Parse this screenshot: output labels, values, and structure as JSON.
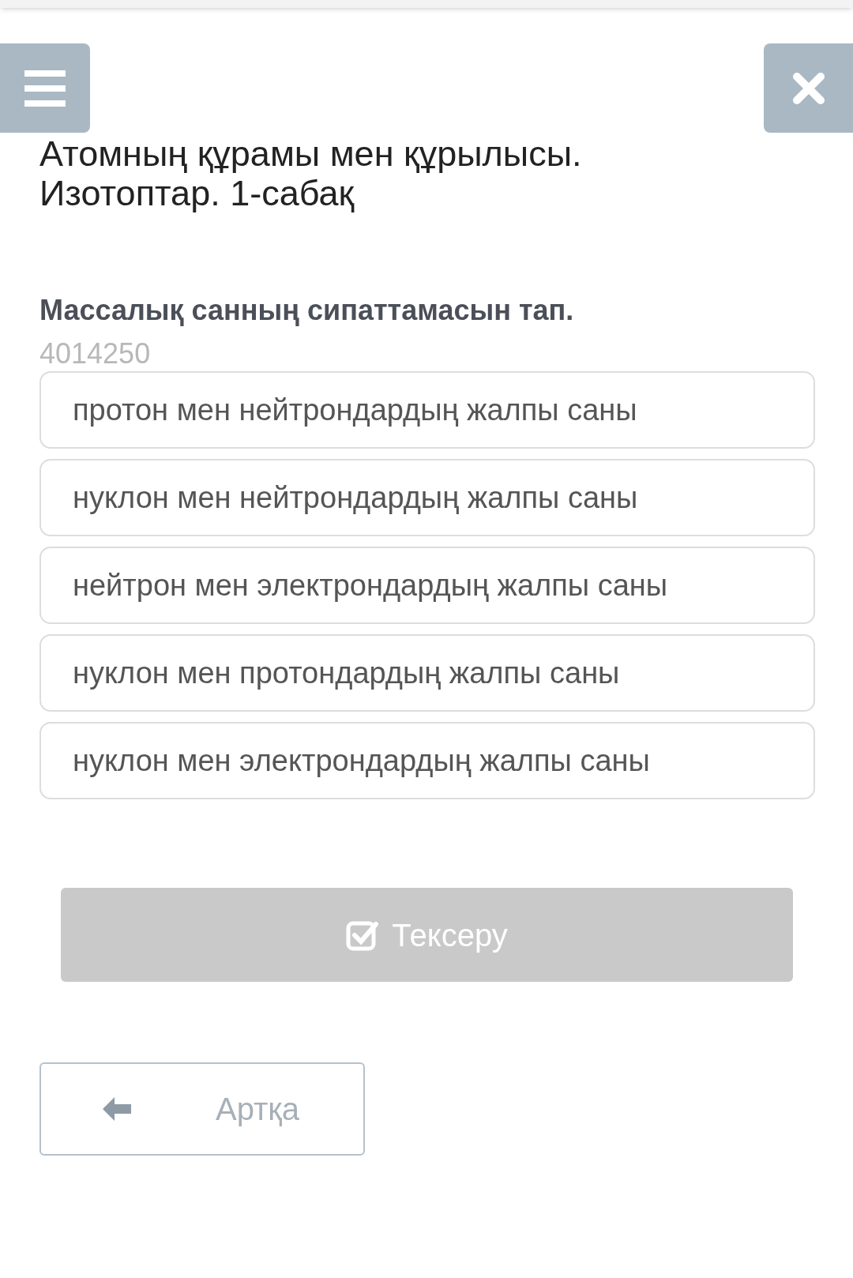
{
  "title": "Атомның құрамы мен құрылысы. Изотоптар. 1-сабақ",
  "question": "Массалық санның сипаттамасын тап.",
  "question_id": "4014250",
  "options": [
    {
      "text": "протон мен нейтрондардың жалпы саны",
      "selected": false
    },
    {
      "text": "нуклон мен нейтрондардың жалпы саны",
      "selected": false
    },
    {
      "text": "нейтрон мен электрондардың жалпы саны",
      "selected": false
    },
    {
      "text": "нуклон мен протондардың жалпы саны",
      "selected": false
    },
    {
      "text": "нуклон мен электрондардың жалпы саны",
      "selected": false
    }
  ],
  "check_button": {
    "label": "Тексеру",
    "disabled": true
  },
  "back_button": {
    "label": "Артқа"
  }
}
